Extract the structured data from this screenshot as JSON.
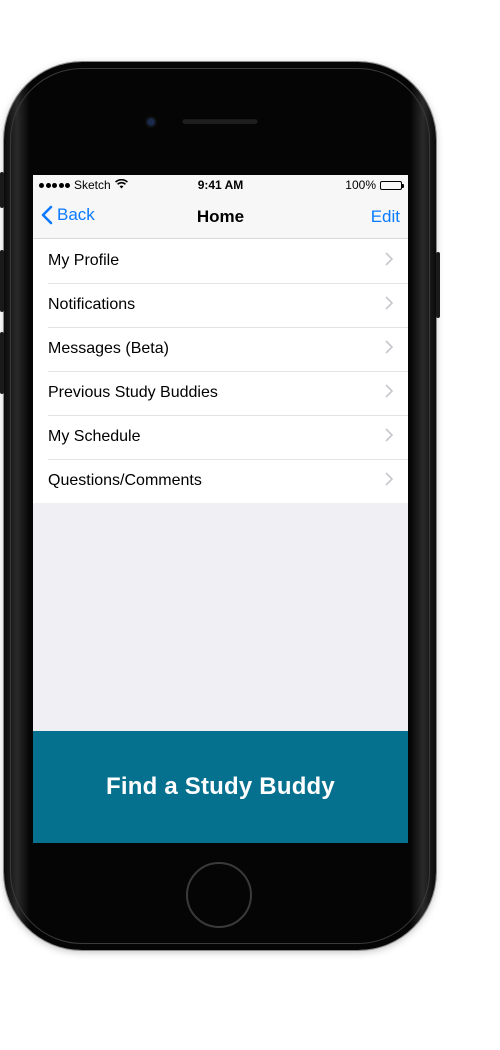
{
  "statusbar": {
    "carrier": "Sketch",
    "time": "9:41 AM",
    "battery": "100%",
    "battery_level": 1.0
  },
  "navbar": {
    "back_label": "Back",
    "title": "Home",
    "edit_label": "Edit"
  },
  "menu": {
    "items": [
      {
        "label": "My Profile"
      },
      {
        "label": "Notifications"
      },
      {
        "label": "Messages (Beta)"
      },
      {
        "label": "Previous Study Buddies"
      },
      {
        "label": "My Schedule"
      },
      {
        "label": "Questions/Comments"
      }
    ]
  },
  "cta": {
    "label": "Find a Study Buddy"
  },
  "colors": {
    "accent": "#0a7aff",
    "cta_background": "#06708f",
    "screen_background": "#efeff4"
  },
  "icons": {
    "back": "chevron-left-icon",
    "row": "chevron-right-icon",
    "wifi": "wifi-icon",
    "battery": "battery-icon"
  }
}
